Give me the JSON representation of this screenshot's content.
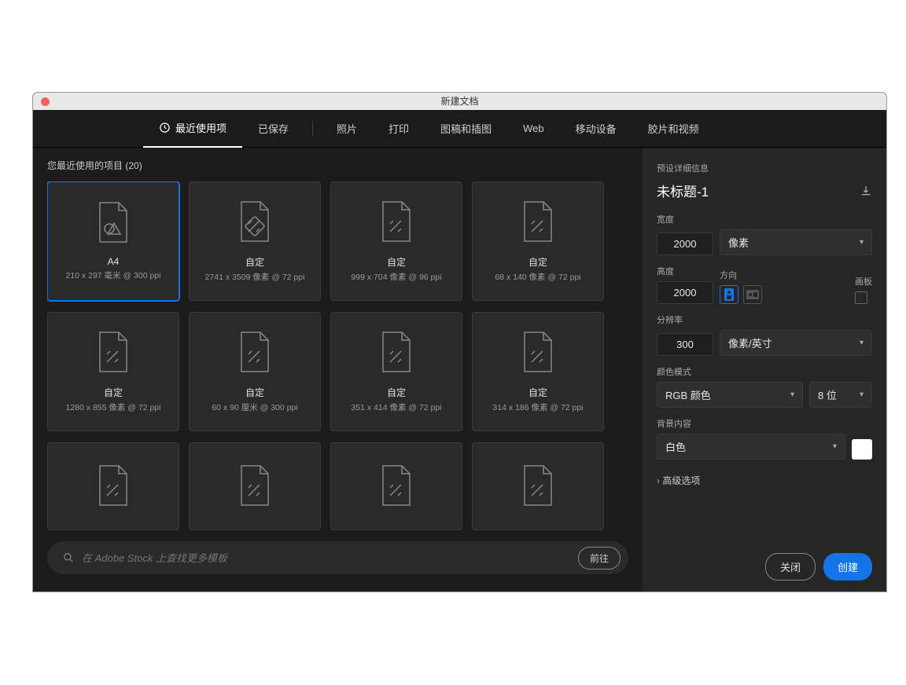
{
  "window": {
    "title": "新建文档"
  },
  "tabs": {
    "recent": "最近使用项",
    "saved": "已保存",
    "photo": "照片",
    "print": "打印",
    "art": "图稿和插图",
    "web": "Web",
    "mobile": "移动设备",
    "film": "胶片和视频"
  },
  "recent": {
    "label": "您最近使用的项目",
    "count": "(20)",
    "cards": [
      {
        "title": "A4",
        "sub": "210 x 297 毫米 @ 300 ppi"
      },
      {
        "title": "自定",
        "sub": "2741 x 3509 像素 @ 72 ppi"
      },
      {
        "title": "自定",
        "sub": "999 x 704 像素 @ 96 ppi"
      },
      {
        "title": "自定",
        "sub": "68 x 140 像素 @ 72 ppi"
      },
      {
        "title": "自定",
        "sub": "1280 x 855 像素 @ 72 ppi"
      },
      {
        "title": "自定",
        "sub": "60 x 90 厘米 @ 300 ppi"
      },
      {
        "title": "自定",
        "sub": "351 x 414 像素 @ 72 ppi"
      },
      {
        "title": "自定",
        "sub": "314 x 186 像素 @ 72 ppi"
      }
    ]
  },
  "search": {
    "placeholder": "在 Adobe Stock 上查找更多模板",
    "go": "前往"
  },
  "preset": {
    "header": "预设详细信息",
    "title": "未标题-1",
    "width_label": "宽度",
    "width": "2000",
    "width_unit": "像素",
    "height_label": "高度",
    "height": "2000",
    "orient_label": "方向",
    "artboard_label": "画板",
    "res_label": "分辨率",
    "res": "300",
    "res_unit": "像素/英寸",
    "color_label": "颜色模式",
    "color_mode": "RGB 颜色",
    "bit_depth": "8 位",
    "bg_label": "背景内容",
    "bg": "白色",
    "bg_color": "#ffffff",
    "advanced": "高级选项"
  },
  "buttons": {
    "close": "关闭",
    "create": "创建"
  }
}
